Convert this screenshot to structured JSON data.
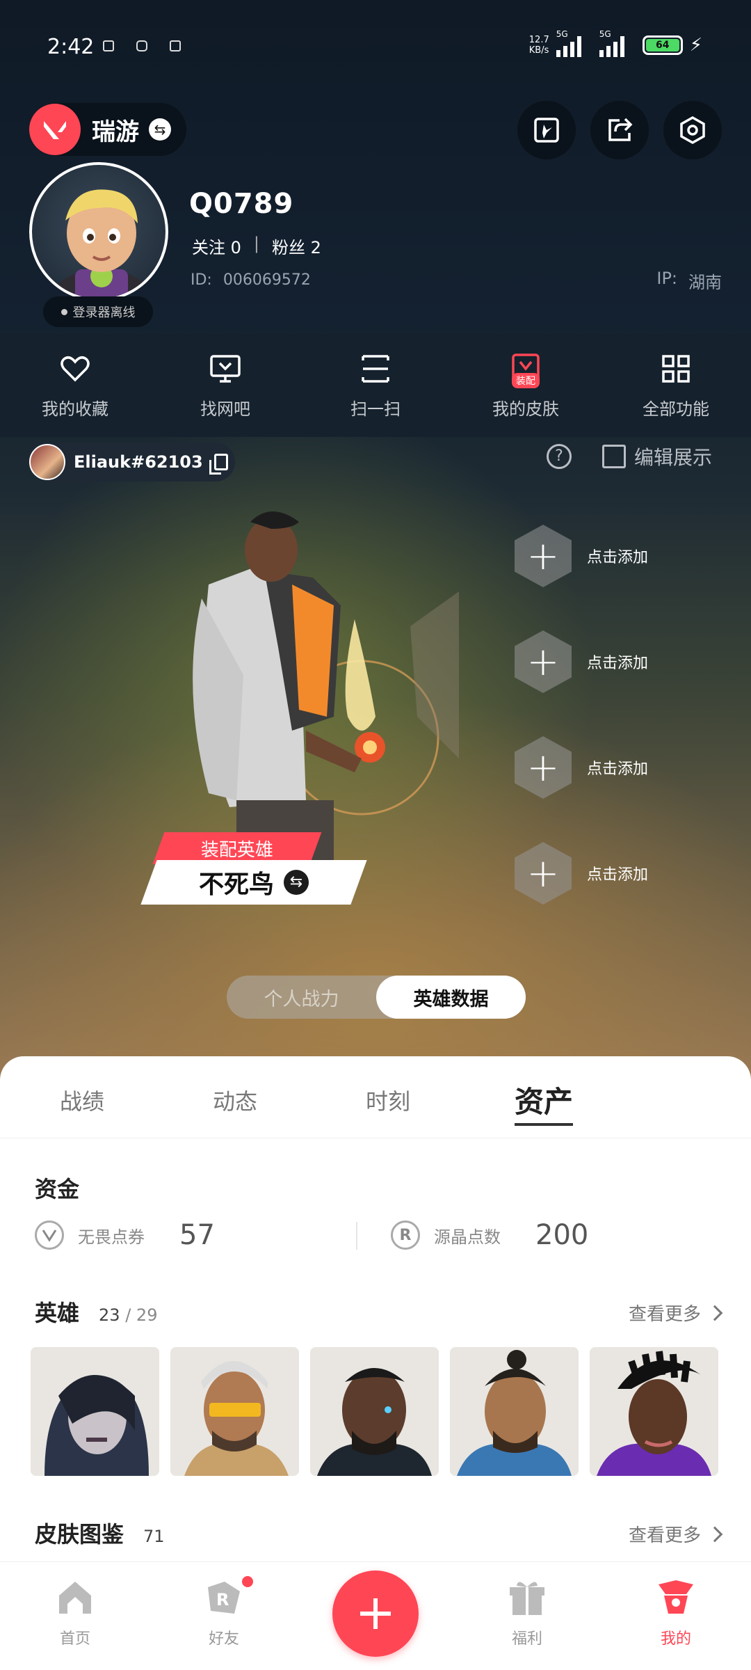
{
  "status": {
    "time": "2:42",
    "netspeed_value": "12.7",
    "netspeed_unit": "KB/s",
    "sim1": "5G",
    "sim2": "5G",
    "battery": "64"
  },
  "header": {
    "app_name": "瑞游",
    "username": "Q0789",
    "follow_label": "关注",
    "follow_count": "0",
    "fans_label": "粉丝",
    "fans_count": "2",
    "id_label": "ID:",
    "id_value": "006069572",
    "ip_label": "IP:",
    "ip_value": "湖南",
    "offline_status": "登录器离线"
  },
  "quick_nav": [
    {
      "label": "我的收藏",
      "icon": "heart-icon"
    },
    {
      "label": "找网吧",
      "icon": "monitor-icon"
    },
    {
      "label": "扫一扫",
      "icon": "scan-icon"
    },
    {
      "label": "我的皮肤",
      "icon": "skin-icon",
      "badge": "装配"
    },
    {
      "label": "全部功能",
      "icon": "grid-icon"
    }
  ],
  "riot": {
    "name": "Eliauk#62103",
    "edit_display": "编辑展示"
  },
  "showcase": {
    "equip_label": "装配英雄",
    "agent_name": "不死鸟",
    "add_slots": [
      "点击添加",
      "点击添加",
      "点击添加",
      "点击添加"
    ],
    "toggle": [
      "个人战力",
      "英雄数据"
    ]
  },
  "tabs": [
    "战绩",
    "动态",
    "时刻",
    "资产"
  ],
  "assets": {
    "funds_title": "资金",
    "currency": [
      {
        "label": "无畏点券",
        "value": "57",
        "icon": "valorant-point-icon"
      },
      {
        "label": "源晶点数",
        "value": "200",
        "icon": "radianite-icon"
      }
    ],
    "heroes_title": "英雄",
    "heroes_owned": "23",
    "heroes_total": "/ 29",
    "more": "查看更多",
    "skins_title": "皮肤图鉴",
    "skins_count": "71"
  },
  "bottom_nav": [
    {
      "label": "首页",
      "icon": "home-icon"
    },
    {
      "label": "好友",
      "icon": "friends-icon"
    },
    {
      "label": "福利",
      "icon": "gift-icon"
    },
    {
      "label": "我的",
      "icon": "profile-icon"
    }
  ],
  "colors": {
    "accent": "#ff4655",
    "dark": "#0f1a26"
  }
}
